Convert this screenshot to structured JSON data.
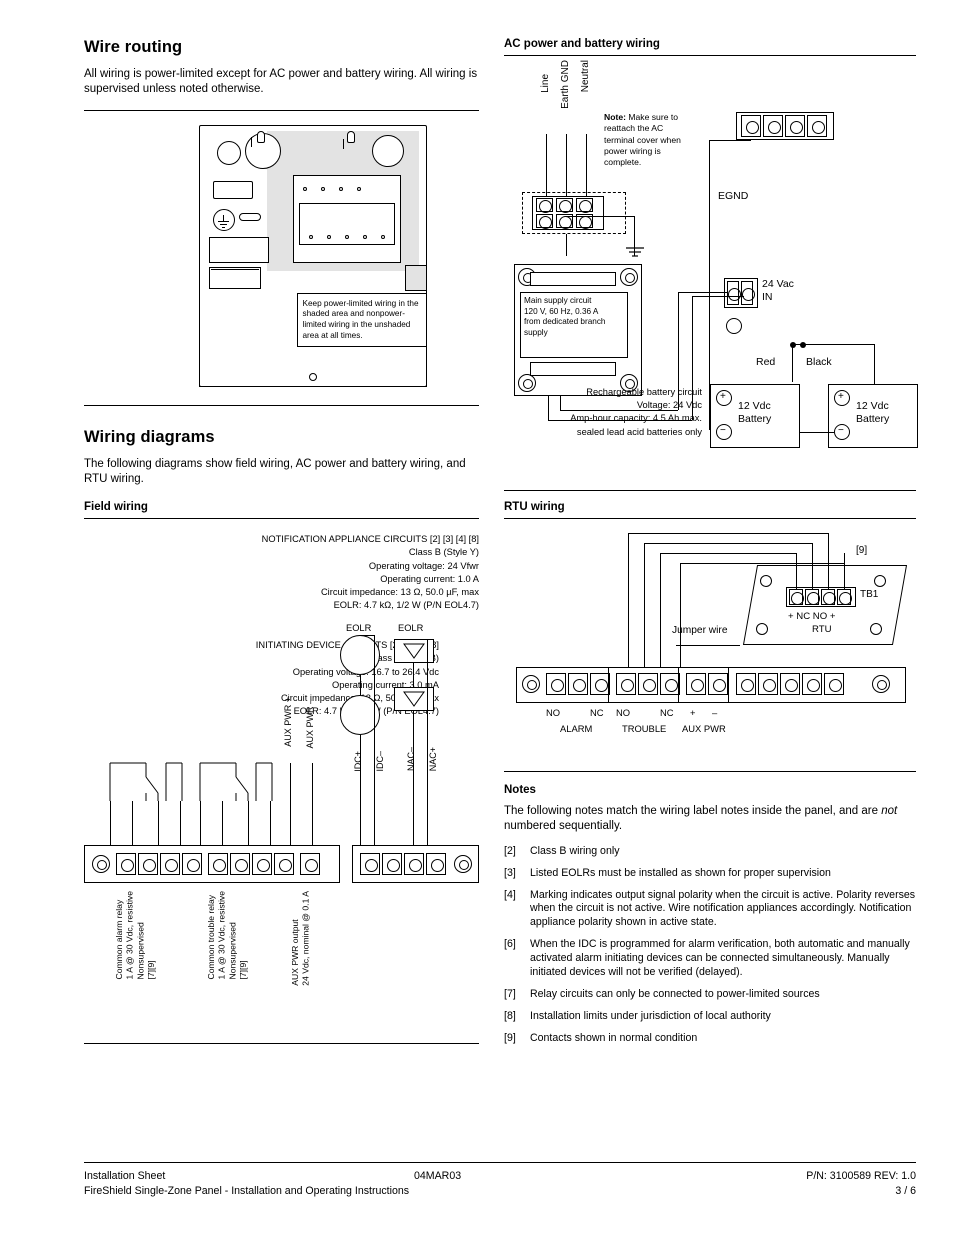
{
  "left": {
    "wire_routing": {
      "heading": "Wire routing",
      "body": "All wiring is power-limited except for AC power and battery wiring. All wiring is supervised unless noted otherwise.",
      "panel_note": "Keep power-limited wiring in the shaded area and nonpower-limited wiring in the unshaded area at all times."
    },
    "wiring_diagrams": {
      "heading": "Wiring diagrams",
      "body": "The following diagrams show field wiring, AC power and battery wiring, and RTU wiring."
    },
    "field_wiring": {
      "heading": "Field wiring",
      "nac_block": [
        "NOTIFICATION APPLIANCE CIRCUITS [2] [3] [4] [8]",
        "Class B (Style Y)",
        "Operating voltage: 24 Vfwr",
        "Operating current: 1.0 A",
        "Circuit impedance: 13 Ω, 50.0 µF, max",
        "EOLR: 4.7 kΩ, 1/2 W (P/N EOL4.7)"
      ],
      "idc_block": [
        "INITIATING DEVICE CIRCUITS [2] [3] [6] [8]",
        "Class B (Style B)",
        "Operating voltage: 16.7 to 26.4 Vdc",
        "Operating current: 3.0 mA",
        "Circuit impedance: 13 Ω, 50.0 µF, max",
        "EOLR: 4.7 kΩ, 1/2 W (P/N EOL4.7)"
      ],
      "eolr_label_left": "EOLR",
      "eolr_label_right": "EOLR",
      "vert_labels": {
        "aux_pwr_plus": "AUX PWR +",
        "aux_pwr_minus": "AUX PWR –",
        "idc_plus": "IDC+",
        "idc_minus": "IDC–",
        "nac_minus": "NAC–",
        "nac_plus": "NAC+"
      },
      "bottom_labels": [
        "Common alarm relay\n1 A @ 30 Vdc, resistive\nNonsupervised\n[7][9]",
        "Common trouble relay\n1 A @ 30 Vdc, resistive\nNonsupervised\n[7][9]",
        "AUX PWR output\n24 Vdc, nominal @ 0.1 A"
      ]
    }
  },
  "right": {
    "ac_power": {
      "heading": "AC power and battery wiring",
      "labels": {
        "line": "Line",
        "earth_gnd": "Earth GND",
        "neutral": "Neutral",
        "egnd": "EGND",
        "note_bold": "Note:",
        "note_text": " Make sure to reattach the AC terminal cover when power wiring is complete.",
        "main_supply": "Main supply circuit\n120 V, 60 Hz, 0.36 A\nfrom dedicated branch\nsupply",
        "vac_in": "24 Vac\nIN",
        "red": "Red",
        "black": "Black",
        "battery1": "12 Vdc\nBattery",
        "battery2": "12 Vdc\nBattery",
        "battery_spec": "Rechargeable battery circuit\nVoltage: 24 Vdc\nAmp-hour capacity: 4.5 Ah max.\nsealed lead acid batteries only",
        "plus": "+",
        "minus": "−"
      }
    },
    "rtu": {
      "heading": "RTU wiring",
      "labels": {
        "ref9": "[9]",
        "tb1": "TB1",
        "nc_no": "+ NC  NO  +",
        "rtu": "RTU",
        "jumper": "Jumper wire",
        "no1": "NO",
        "nc1": "NC",
        "no2": "NO",
        "nc2": "NC",
        "plus": "+",
        "minus": "–",
        "alarm": "ALARM",
        "trouble": "TROUBLE",
        "aux_pwr": "AUX PWR"
      }
    },
    "notes": {
      "heading": "Notes",
      "intro_1": "The following notes match the wiring label notes inside the panel, and are ",
      "intro_italic": "not",
      "intro_2": " numbered sequentially.",
      "items": [
        {
          "num": "[2]",
          "text": "Class B wiring only"
        },
        {
          "num": "[3]",
          "text": "Listed EOLRs must be installed as shown for proper supervision"
        },
        {
          "num": "[4]",
          "text": "Marking indicates output signal polarity when the circuit is active. Polarity reverses when the circuit is not active. Wire notification appliances accordingly. Notification appliance polarity shown in active state."
        },
        {
          "num": "[6]",
          "text": "When the IDC is programmed for alarm verification, both automatic and manually activated alarm initiating devices can be connected simultaneously. Manually initiated devices will not be verified (delayed)."
        },
        {
          "num": "[7]",
          "text": "Relay circuits can only be connected to power-limited sources"
        },
        {
          "num": "[8]",
          "text": "Installation limits under jurisdiction of local authority"
        },
        {
          "num": "[9]",
          "text": "Contacts shown in normal condition"
        }
      ]
    }
  },
  "footer": {
    "line1_left": "Installation Sheet",
    "line1_mid": "04MAR03",
    "line1_right": "P/N: 3100589 REV: 1.0",
    "line2_left": "FireShield Single-Zone Panel - Installation and Operating Instructions",
    "line2_right": "3 / 6"
  }
}
